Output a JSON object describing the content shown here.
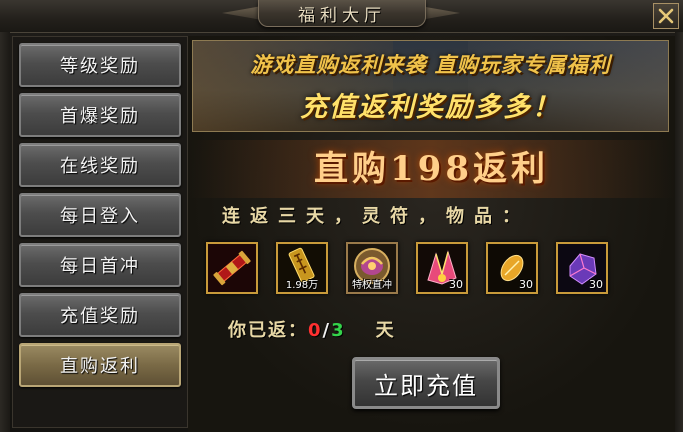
{
  "window": {
    "title": "福利大厅"
  },
  "sidebar": {
    "items": [
      {
        "label": "等级奖励",
        "active": false
      },
      {
        "label": "首爆奖励",
        "active": false
      },
      {
        "label": "在线奖励",
        "active": false
      },
      {
        "label": "每日登入",
        "active": false
      },
      {
        "label": "每日首冲",
        "active": false
      },
      {
        "label": "充值奖励",
        "active": false
      },
      {
        "label": "直购返利",
        "active": true
      }
    ]
  },
  "banner": {
    "line1": "游戏直购返利来袭 直购玩家专属福利",
    "line2": "充值返利奖励多多！"
  },
  "panel": {
    "headline": "直购198返利",
    "subtitle": "连返三天，灵符，物品：",
    "progress": {
      "label": "你已返：",
      "current": "0",
      "separator": "/",
      "goal": "3",
      "unit": "天"
    },
    "button_label": "立即充值"
  },
  "rewards": [
    {
      "icon": "red-scroll-icon",
      "text": ""
    },
    {
      "icon": "gold-talisman-icon",
      "text": "1.98万"
    },
    {
      "icon": "privilege-helmet-icon",
      "text": "特权直冲"
    },
    {
      "icon": "pink-crystal-icon",
      "text": "30"
    },
    {
      "icon": "golden-seed-icon",
      "text": "30"
    },
    {
      "icon": "purple-gem-icon",
      "text": "30"
    }
  ],
  "colors": {
    "accent_gold": "#c89a3a",
    "progress_current": "#ff3030",
    "progress_goal": "#34d34a"
  }
}
